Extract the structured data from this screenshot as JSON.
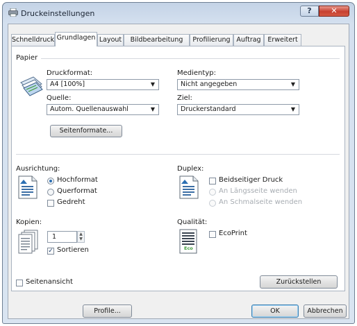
{
  "window": {
    "title": "Druckeinstellungen",
    "help_label": "?",
    "close_label": "✕"
  },
  "tabs": [
    "Schnelldruck",
    "Grundlagen",
    "Layout",
    "Bildbearbeitung",
    "Profilierung",
    "Auftrag",
    "Erweitert"
  ],
  "active_tab": "Grundlagen",
  "paper": {
    "section_label": "Papier",
    "format_label": "Druckformat:",
    "format_value": "A4 [100%]",
    "media_label": "Medientyp:",
    "media_value": "Nicht angegeben",
    "source_label": "Quelle:",
    "source_value": "Autom. Quellenauswahl",
    "target_label": "Ziel:",
    "target_value": "Druckerstandard",
    "formats_button": "Seitenformate..."
  },
  "orientation": {
    "label": "Ausrichtung:",
    "portrait": "Hochformat",
    "landscape": "Querformat",
    "rotated": "Gedreht",
    "selected": "portrait",
    "rotated_checked": false
  },
  "duplex": {
    "label": "Duplex:",
    "two_sided": "Beidseitiger Druck",
    "long_edge": "An Längsseite wenden",
    "short_edge": "An Schmalseite wenden",
    "two_sided_checked": false
  },
  "copies": {
    "label": "Kopien:",
    "value": "1",
    "collate": "Sortieren",
    "collate_checked": true
  },
  "quality": {
    "label": "Qualität:",
    "ecoprint": "EcoPrint",
    "ecoprint_checked": false,
    "eco_icon_text": "Eco"
  },
  "page_view": {
    "label": "Seitenansicht",
    "checked": false
  },
  "reset_button": "Zurückstellen",
  "profile_button": "Profile...",
  "ok_button": "OK",
  "cancel_button": "Abbrechen",
  "colors": {
    "accent": "#2b6fb3",
    "close_red": "#c7402f",
    "eco_green": "#3f9b3a"
  }
}
